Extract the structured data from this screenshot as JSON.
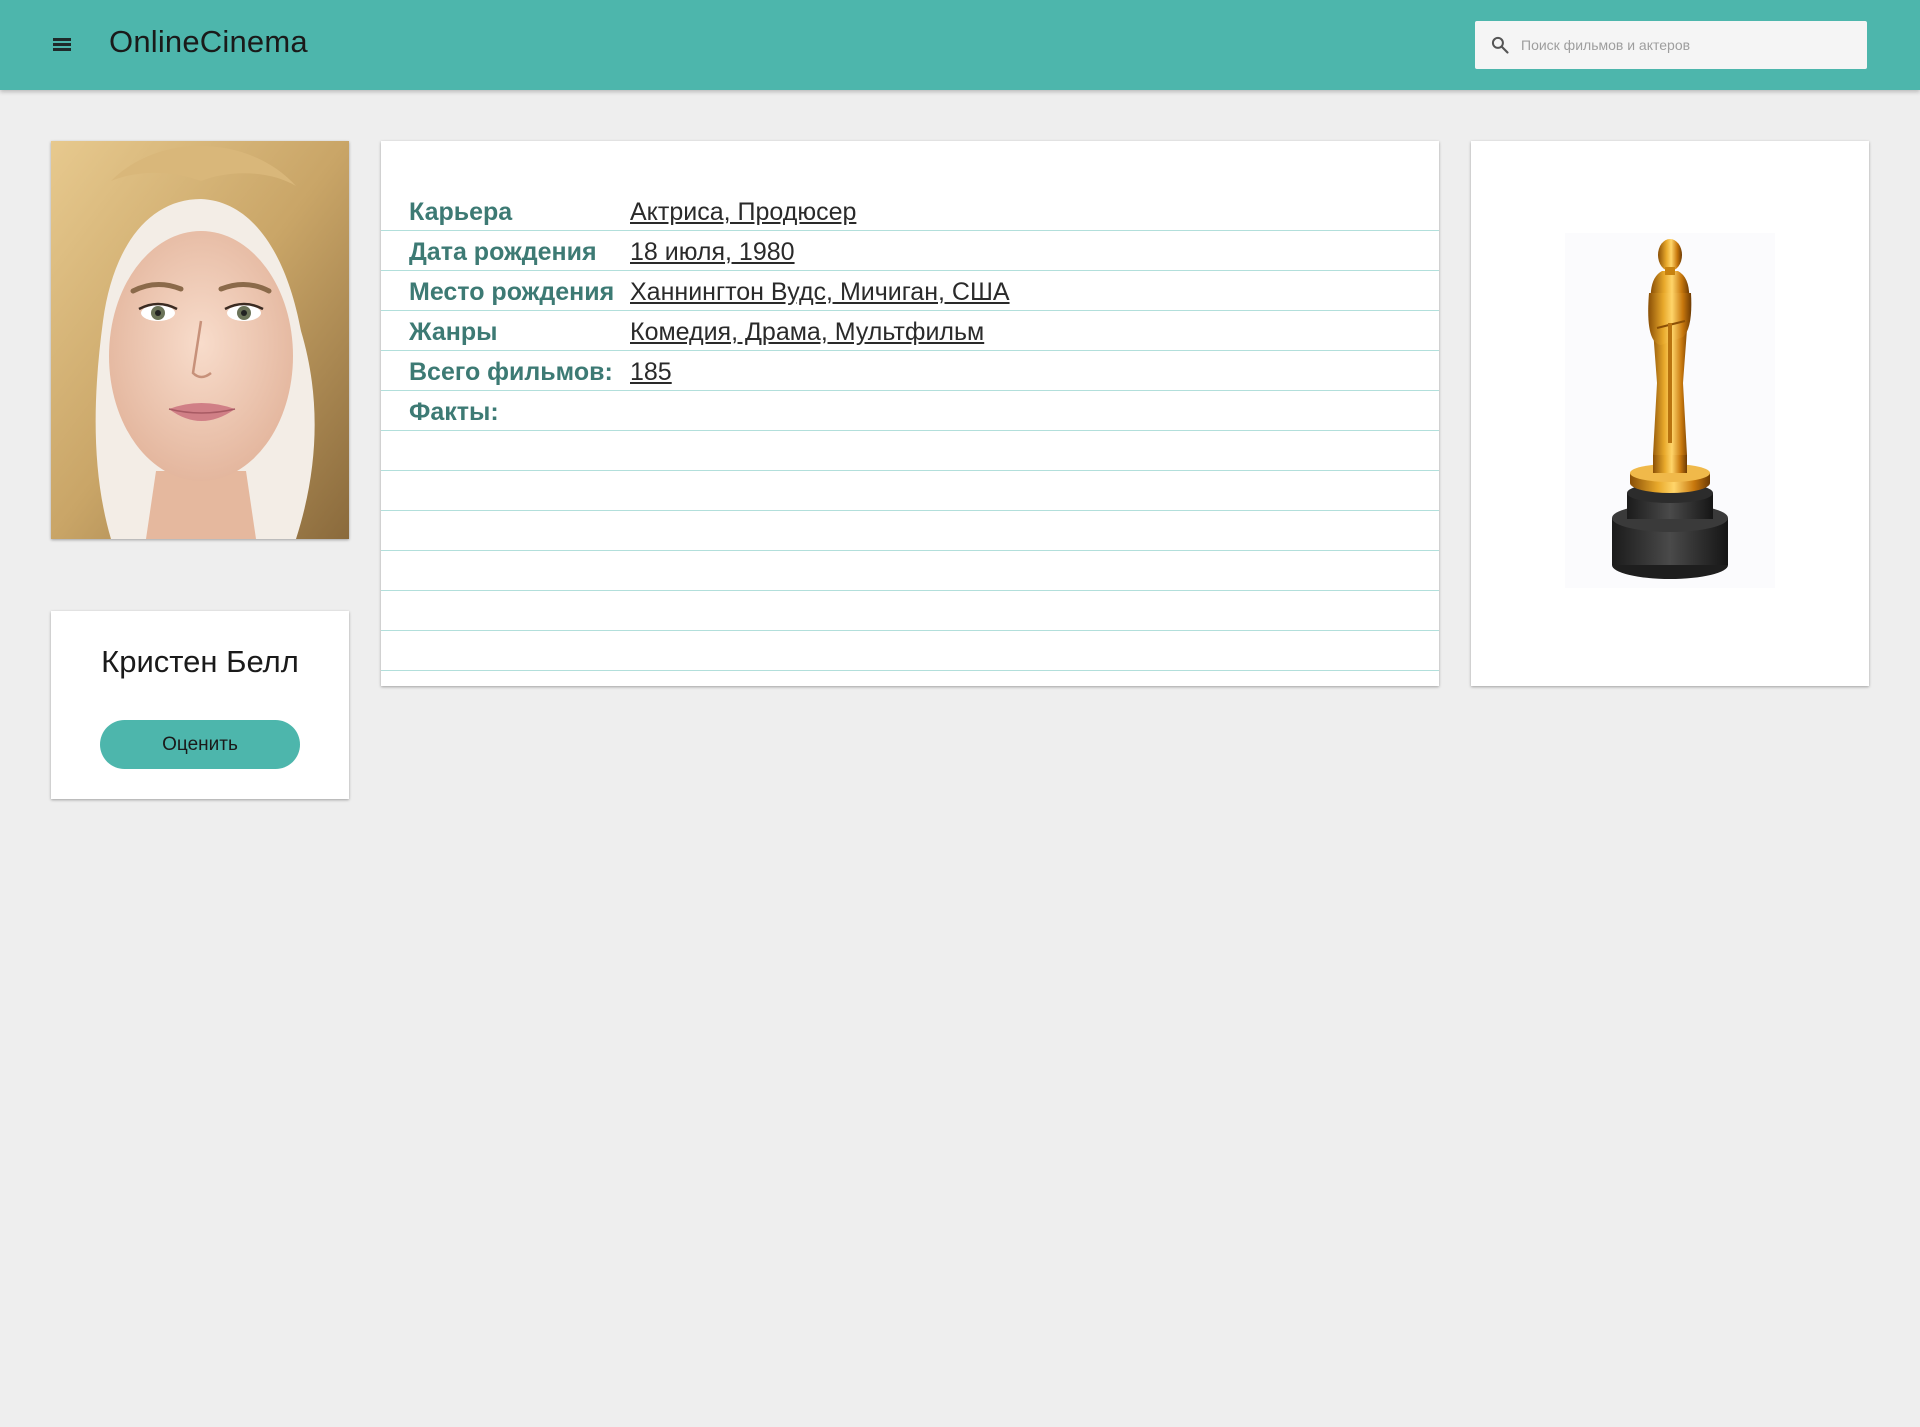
{
  "header": {
    "brand": "OnlineCinema",
    "search_placeholder": "Поиск фильмов и актеров"
  },
  "actor": {
    "name": "Кристен Белл",
    "rate_label": "Оценить"
  },
  "info": {
    "rows": [
      {
        "label": "Карьера",
        "value": "Актриса, Продюсер"
      },
      {
        "label": "Дата рождения",
        "value": "18 июля, 1980"
      },
      {
        "label": "Место рождения",
        "value": "Ханнингтон Вудс, Мичиган, США"
      },
      {
        "label": "Жанры",
        "value": "Комедия, Драма, Мультфильм"
      },
      {
        "label": "Всего фильмов:",
        "value": "185"
      },
      {
        "label": "Факты:",
        "value": ""
      }
    ]
  },
  "colors": {
    "accent": "#4db6ac",
    "label": "#3d7a74",
    "divider": "#b2dfdb",
    "background": "#eeeeee"
  },
  "icons": {
    "menu": "menu-icon",
    "search": "search-icon",
    "portrait": "actor-portrait",
    "award": "oscar-statuette-icon"
  }
}
